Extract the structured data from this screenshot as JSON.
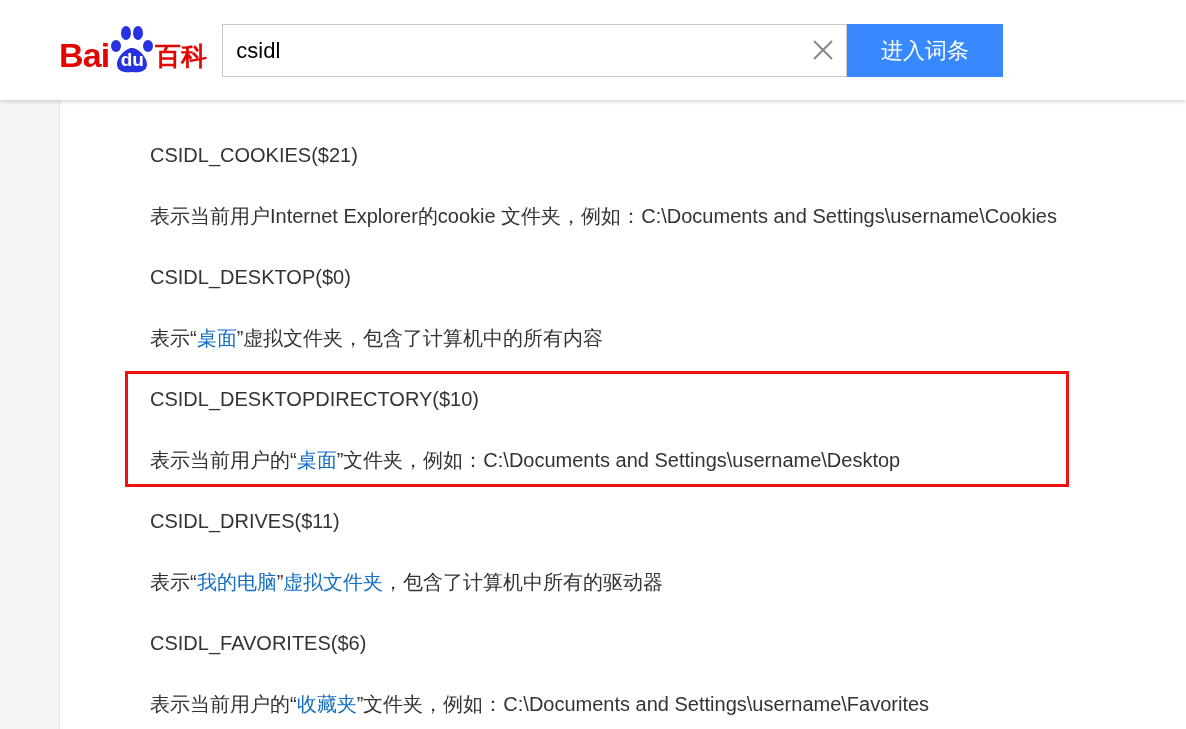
{
  "logo": {
    "left": "Bai",
    "paw": "du",
    "right": "百科"
  },
  "search": {
    "value": "csidl",
    "button": "进入词条"
  },
  "entries": [
    {
      "term": "CSIDL_COOKIES($21)",
      "highlighted": false,
      "desc": [
        {
          "text": "表示当前用户Internet Explorer的cookie 文件夹，例如：C:\\Documents and Settings\\username\\Cookies",
          "link": false
        }
      ]
    },
    {
      "term": "CSIDL_DESKTOP($0)",
      "highlighted": false,
      "desc": [
        {
          "text": "表示“",
          "link": false
        },
        {
          "text": "桌面",
          "link": true
        },
        {
          "text": "”虚拟文件夹，包含了计算机中的所有内容",
          "link": false
        }
      ]
    },
    {
      "term": "CSIDL_DESKTOPDIRECTORY($10)",
      "highlighted": true,
      "desc": [
        {
          "text": "表示当前用户的“",
          "link": false
        },
        {
          "text": "桌面",
          "link": true
        },
        {
          "text": "”文件夹，例如：C:\\Documents and Settings\\username\\Desktop",
          "link": false
        }
      ]
    },
    {
      "term": "CSIDL_DRIVES($11)",
      "highlighted": false,
      "desc": [
        {
          "text": "表示“",
          "link": false
        },
        {
          "text": "我的电脑",
          "link": true
        },
        {
          "text": "”",
          "link": false
        },
        {
          "text": "虚拟文件夹",
          "link": true
        },
        {
          "text": "，包含了计算机中所有的驱动器",
          "link": false
        }
      ]
    },
    {
      "term": "CSIDL_FAVORITES($6)",
      "highlighted": false,
      "desc": [
        {
          "text": "表示当前用户的“",
          "link": false
        },
        {
          "text": "收藏夹",
          "link": true
        },
        {
          "text": "”文件夹，例如：C:\\Documents and Settings\\username\\Favorites",
          "link": false
        }
      ]
    }
  ]
}
